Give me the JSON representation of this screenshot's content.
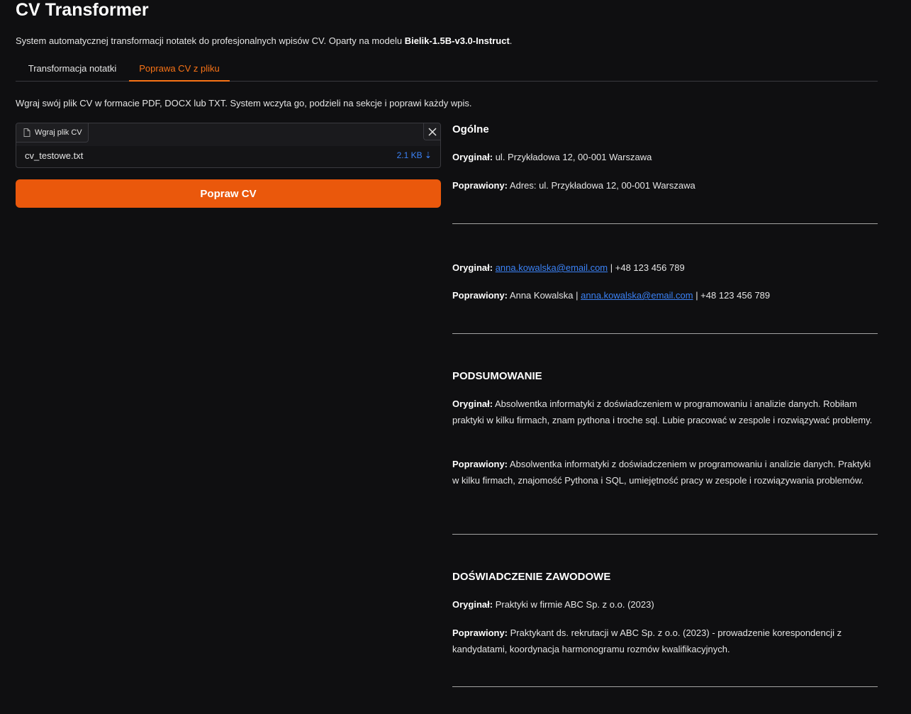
{
  "app": {
    "title": "CV Transformer",
    "subtitle_prefix": "System automatycznej transformacji notatek do profesjonalnych wpisów CV. Oparty na modelu ",
    "subtitle_model": "Bielik-1.5B-v3.0-Instruct",
    "subtitle_suffix": "."
  },
  "tabs": [
    {
      "label": "Transformacja notatki",
      "active": false
    },
    {
      "label": "Poprawa CV z pliku",
      "active": true
    }
  ],
  "instruction": "Wgraj swój plik CV w formacie PDF, DOCX lub TXT. System wczyta go, podzieli na sekcje i poprawi każdy wpis.",
  "upload": {
    "label": "Wgraj plik CV",
    "file_name": "cv_testowe.txt",
    "file_size": "2.1 KB ⇣"
  },
  "submit_label": "Popraw CV",
  "labels": {
    "original": "Oryginał:",
    "corrected": "Poprawiony:"
  },
  "results": {
    "s1": {
      "title": "Ogólne",
      "original": "ul. Przykładowa 12, 00-001 Warszawa",
      "corrected": "Adres: ul. Przykładowa 12, 00-001 Warszawa"
    },
    "s2": {
      "title": "",
      "original_email": "anna.kowalska@email.com",
      "original_rest": " | +48 123 456 789",
      "corrected_prefix": "Anna Kowalska | ",
      "corrected_email": "anna.kowalska@email.com",
      "corrected_rest": " | +48 123 456 789"
    },
    "s3": {
      "title": "PODSUMOWANIE",
      "original": "Absolwentka informatyki z doświadczeniem w programowaniu i analizie danych. Robiłam praktyki w kilku firmach, znam pythona i troche sql. Lubie pracować w zespole i rozwiązywać problemy.",
      "corrected": "Absolwentka informatyki z doświadczeniem w programowaniu i analizie danych. Praktyki w kilku firmach, znajomość Pythona i SQL, umiejętność pracy w zespole i rozwiązywania problemów."
    },
    "s4": {
      "title": "DOŚWIADCZENIE ZAWODOWE",
      "original": "Praktyki w firmie ABC Sp. z o.o. (2023)",
      "corrected": "Praktykant ds. rekrutacji w ABC Sp. z o.o. (2023) - prowadzenie korespondencji z kandydatami, koordynacja harmonogramu rozmów kwalifikacyjnych."
    }
  },
  "colors": {
    "background": "#0f0f11",
    "accent": "#ea580c",
    "tab_active": "#f97316",
    "link": "#3b82f6"
  }
}
